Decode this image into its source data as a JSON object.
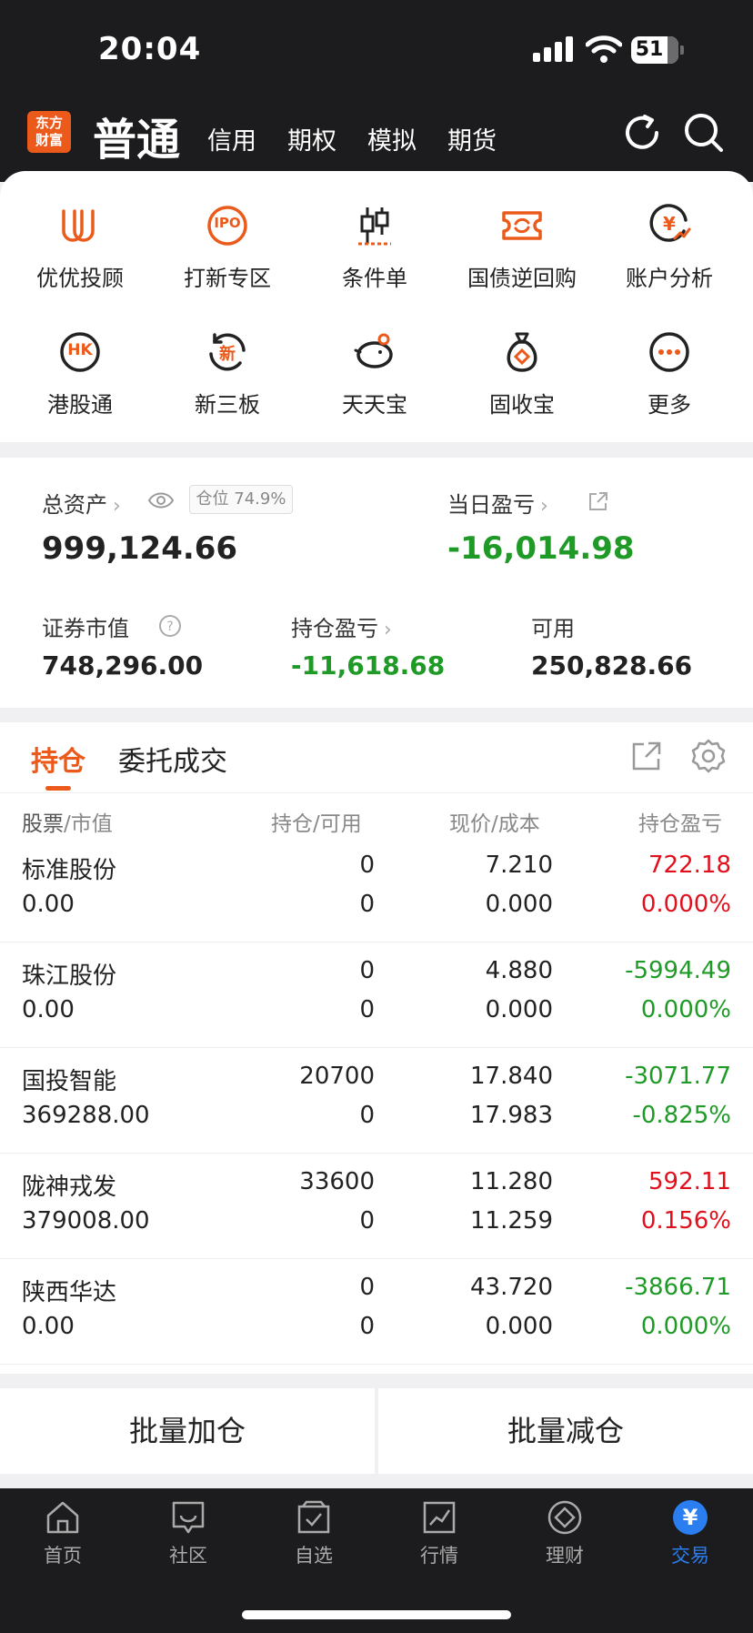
{
  "status": {
    "time": "20:04",
    "battery": "51"
  },
  "header": {
    "logo_line1": "东方",
    "logo_line2": "财富",
    "tab_active": "普通",
    "tabs": [
      "信用",
      "期权",
      "模拟",
      "期货"
    ],
    "icons": [
      "refresh-icon",
      "search-icon"
    ]
  },
  "quick": {
    "row1": [
      "优优投顾",
      "打新专区",
      "条件单",
      "国债逆回购",
      "账户分析"
    ],
    "row2": [
      "港股通",
      "新三板",
      "天天宝",
      "固收宝",
      "更多"
    ],
    "ipo_text": "IPO",
    "hk_text": "HK",
    "new_text": "新"
  },
  "assets": {
    "total_label": "总资产",
    "position_badge": "仓位 74.9%",
    "total_value": "999,124.66",
    "daily_label": "当日盈亏",
    "daily_value": "-16,014.98",
    "market_label": "证券市值",
    "market_value": "748,296.00",
    "hold_pl_label": "持仓盈亏",
    "hold_pl_value": "-11,618.68",
    "avail_label": "可用",
    "avail_value": "250,828.66"
  },
  "holdings": {
    "tab_active": "持仓",
    "tab_other": "委托成交",
    "columns": {
      "c1a": "股票",
      "c1b": "/市值",
      "c2a": "持仓",
      "c2b": "/可用",
      "c3a": "现价",
      "c3b": "/成本",
      "c4": "持仓盈亏"
    },
    "rows": [
      {
        "name": "标准股份",
        "mv": "0.00",
        "pos": "0",
        "avail": "0",
        "price": "7.210",
        "cost": "0.000",
        "pl": "722.18",
        "pct": "0.000%",
        "color": "red"
      },
      {
        "name": "珠江股份",
        "mv": "0.00",
        "pos": "0",
        "avail": "0",
        "price": "4.880",
        "cost": "0.000",
        "pl": "-5994.49",
        "pct": "0.000%",
        "color": "green"
      },
      {
        "name": "国投智能",
        "mv": "369288.00",
        "pos": "20700",
        "avail": "0",
        "price": "17.840",
        "cost": "17.983",
        "pl": "-3071.77",
        "pct": "-0.825%",
        "color": "green"
      },
      {
        "name": "陇神戎发",
        "mv": "379008.00",
        "pos": "33600",
        "avail": "0",
        "price": "11.280",
        "cost": "11.259",
        "pl": "592.11",
        "pct": "0.156%",
        "color": "red"
      },
      {
        "name": "陕西华达",
        "mv": "0.00",
        "pos": "0",
        "avail": "0",
        "price": "43.720",
        "cost": "0.000",
        "pl": "-3866.71",
        "pct": "0.000%",
        "color": "green"
      }
    ]
  },
  "batch": {
    "add": "批量加仓",
    "reduce": "批量减仓"
  },
  "nav": {
    "items": [
      "首页",
      "社区",
      "自选",
      "行情",
      "理财",
      "交易"
    ],
    "active": "交易",
    "yen": "¥"
  },
  "colors": {
    "accent": "#ec5a1b",
    "red": "#e0101d",
    "green": "#1f9a27",
    "nav_active": "#2a7ef0"
  }
}
